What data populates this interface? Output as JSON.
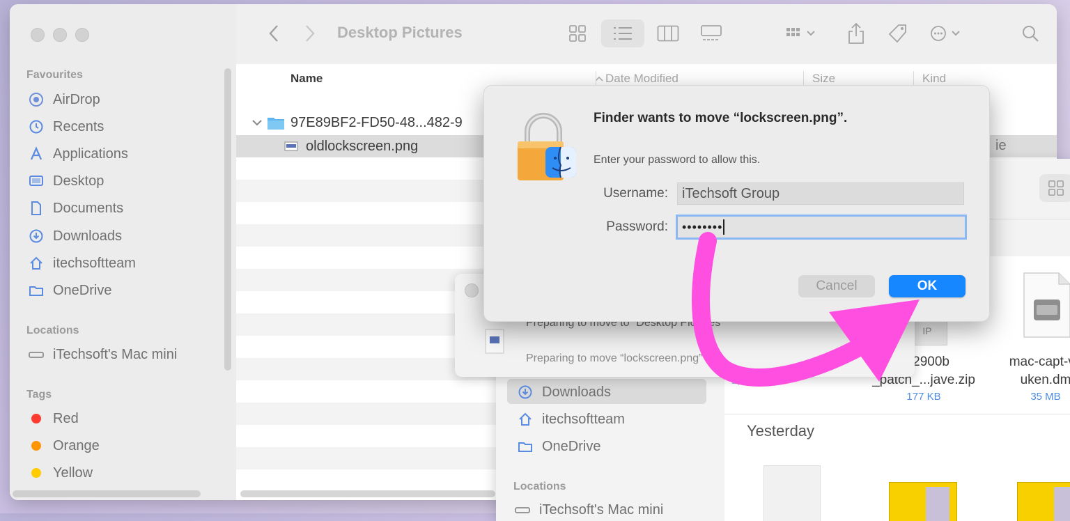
{
  "finder": {
    "title": "Desktop Pictures",
    "sidebar": {
      "favourites_header": "Favourites",
      "favourites": [
        {
          "label": "AirDrop",
          "icon": "airdrop-icon"
        },
        {
          "label": "Recents",
          "icon": "clock-icon"
        },
        {
          "label": "Applications",
          "icon": "applications-icon"
        },
        {
          "label": "Desktop",
          "icon": "desktop-icon"
        },
        {
          "label": "Documents",
          "icon": "document-icon"
        },
        {
          "label": "Downloads",
          "icon": "download-icon"
        },
        {
          "label": "itechsoftteam",
          "icon": "home-icon"
        },
        {
          "label": "OneDrive",
          "icon": "folder-icon"
        }
      ],
      "locations_header": "Locations",
      "locations": [
        {
          "label": "iTechsoft's Mac mini",
          "icon": "computer-icon"
        }
      ],
      "tags_header": "Tags",
      "tags": [
        {
          "label": "Red",
          "color": "#ff3b30"
        },
        {
          "label": "Orange",
          "color": "#ff9500"
        },
        {
          "label": "Yellow",
          "color": "#ffcc00"
        }
      ]
    },
    "columns": {
      "name": "Name",
      "date": "Date Modified",
      "size": "Size",
      "kind": "Kind"
    },
    "rows": [
      {
        "name": "97E89BF2-FD50-48...482-9",
        "type": "folder"
      },
      {
        "name": "oldlockscreen.png",
        "type": "file"
      }
    ],
    "partial_kind": "ie"
  },
  "progress_window": {
    "line1": "Preparing to move to “Desktop Pictures”",
    "line2": "Preparing to move “lockscreen.png”"
  },
  "finder2": {
    "sidebar": [
      {
        "label": "Downloads",
        "icon": "download-icon"
      },
      {
        "label": "itechsoftteam",
        "icon": "home-icon"
      },
      {
        "label": "OneDrive",
        "icon": "folder-icon"
      }
    ],
    "locations_header": "Locations",
    "location": "iTechsoft's Mac mini",
    "section_yesterday": "Yesterday",
    "files": [
      {
        "line1": "op2900b",
        "line2": "_patch_...jave.zip",
        "size": "177 KB",
        "badge": "IP"
      },
      {
        "line1": "mac-capt-v1",
        "line2": "uken.dm",
        "size": "35 MB"
      }
    ],
    "partial_size": "2,2GB"
  },
  "dialog": {
    "title": "Finder wants to move “lockscreen.png”.",
    "subtitle": "Enter your password to allow this.",
    "username_label": "Username:",
    "username_value": "iTechsoft Group",
    "password_label": "Password:",
    "password_value": "••••••••",
    "cancel_label": "Cancel",
    "ok_label": "OK"
  },
  "colors": {
    "accent": "#1787ff",
    "annotation_arrow": "#ff4fe0"
  }
}
